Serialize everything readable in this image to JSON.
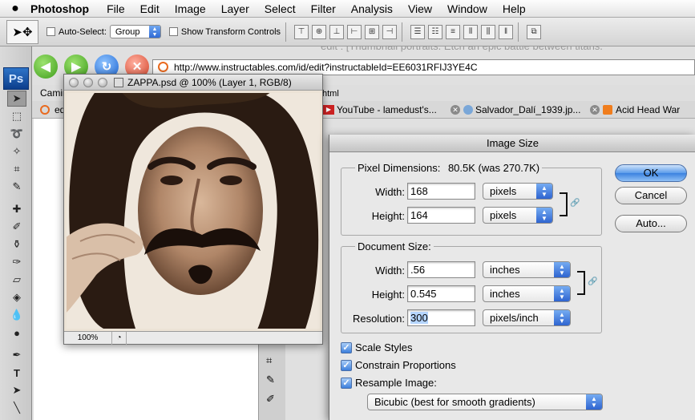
{
  "menubar": {
    "app_name": "Photoshop",
    "items": [
      "File",
      "Edit",
      "Image",
      "Layer",
      "Select",
      "Filter",
      "Analysis",
      "View",
      "Window",
      "Help"
    ]
  },
  "options_bar": {
    "auto_select_label": "Auto-Select:",
    "auto_select_value": "Group",
    "show_transform_label": "Show Transform Controls"
  },
  "browser": {
    "url": "http://www.instructables.com/id/edit?instructableId=EE6031RFIJ3YE4C",
    "bg_text": "edit : [Thumbnail portraits. Etch an epic battle between titans.",
    "bookmark_partial": "Camir",
    "tab_partial": "ed",
    "crumb": "html",
    "tabs": [
      {
        "label": "YouTube - lamedust's..."
      },
      {
        "label": "Salvador_Dalí_1939.jp..."
      },
      {
        "label": "Acid Head War"
      }
    ]
  },
  "toolbox": {
    "logo": "Ps"
  },
  "document": {
    "title": "ZAPPA.psd @ 100% (Layer 1, RGB/8)",
    "zoom": "100%"
  },
  "dialog": {
    "title": "Image Size",
    "pixel_dimensions": {
      "label": "Pixel Dimensions:",
      "summary": "80.5K (was 270.7K)",
      "width_label": "Width:",
      "width_value": "168",
      "width_unit": "pixels",
      "height_label": "Height:",
      "height_value": "164",
      "height_unit": "pixels"
    },
    "document_size": {
      "label": "Document Size:",
      "width_label": "Width:",
      "width_value": ".56",
      "width_unit": "inches",
      "height_label": "Height:",
      "height_value": "0.545",
      "height_unit": "inches",
      "resolution_label": "Resolution:",
      "resolution_value": "300",
      "resolution_unit": "pixels/inch"
    },
    "checkboxes": {
      "scale_styles": "Scale Styles",
      "constrain_proportions": "Constrain Proportions",
      "resample_image": "Resample Image:"
    },
    "resample_method": "Bicubic (best for smooth gradients)",
    "buttons": {
      "ok": "OK",
      "cancel": "Cancel",
      "auto": "Auto..."
    }
  }
}
